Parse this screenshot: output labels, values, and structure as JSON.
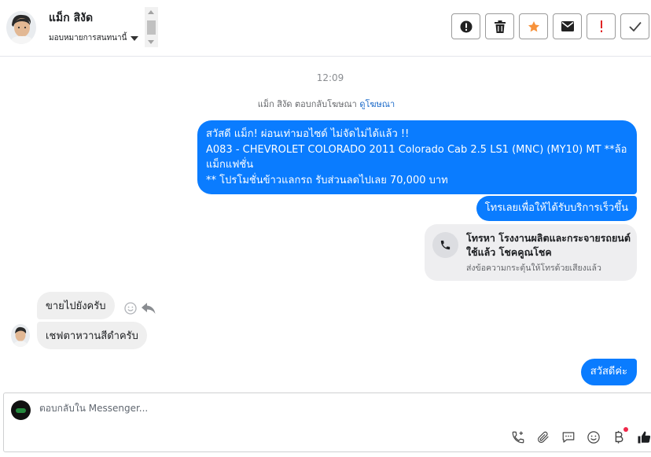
{
  "contact": {
    "name": "แม็ก สิงัด",
    "assign_label": "มอบหมายการสนทนานี้"
  },
  "header_actions": [
    {
      "name": "spam-button",
      "icon": "alert-circle-icon"
    },
    {
      "name": "delete-button",
      "icon": "trash-icon"
    },
    {
      "name": "star-button",
      "icon": "star-icon",
      "color": "#f7923b"
    },
    {
      "name": "unread-button",
      "icon": "envelope-icon"
    },
    {
      "name": "important-button",
      "icon": "exclamation-icon",
      "color": "#e02424"
    },
    {
      "name": "done-button",
      "icon": "check-icon"
    }
  ],
  "conversation": {
    "time": "12:09",
    "ad_notice": "แม็ก สิงัด ตอบกลับโฆษณา",
    "ad_link": "ดูโฆษณา",
    "messages": {
      "main": "สวัสดี แม็ก! ผ่อนเท่ามอไซด์ ไม่จัดไม่ได้แล้ว !!\nA083 - CHEVROLET COLORADO 2011 Colorado Cab 2.5 LS1 (MNC) (MY10) MT **ล้อแม็กแฟชั่น\n** โปรโมชั่นข้าวแลกรถ รับส่วนลดไปเลย 70,000 บาท",
      "call_prompt": "โทรเลยเพื่อให้ได้รับบริการเร็วขึ้น",
      "call_card_title": "โทรหา โรงงานผลิตและกระจายรถยนต์ใช้แล้ว โชคคูณโชค",
      "call_card_sub": "ส่งข้อความกระตุ้นให้โทรด้วยเสียงแล้ว",
      "in_1": "ขายไปยังครับ",
      "in_2": "เชฟตาหวานสีดำครับ",
      "out_hi": "สวัสดีค่ะ"
    }
  },
  "composer": {
    "placeholder": "ตอบกลับใน Messenger...",
    "tools": [
      "phone-plus-icon",
      "attachment-icon",
      "chat-icon",
      "emoji-icon",
      "baht-icon",
      "like-icon"
    ]
  },
  "colors": {
    "outgoing_bubble": "#0a7cff",
    "incoming_bubble": "#efefef",
    "link": "#1b6ac9"
  }
}
